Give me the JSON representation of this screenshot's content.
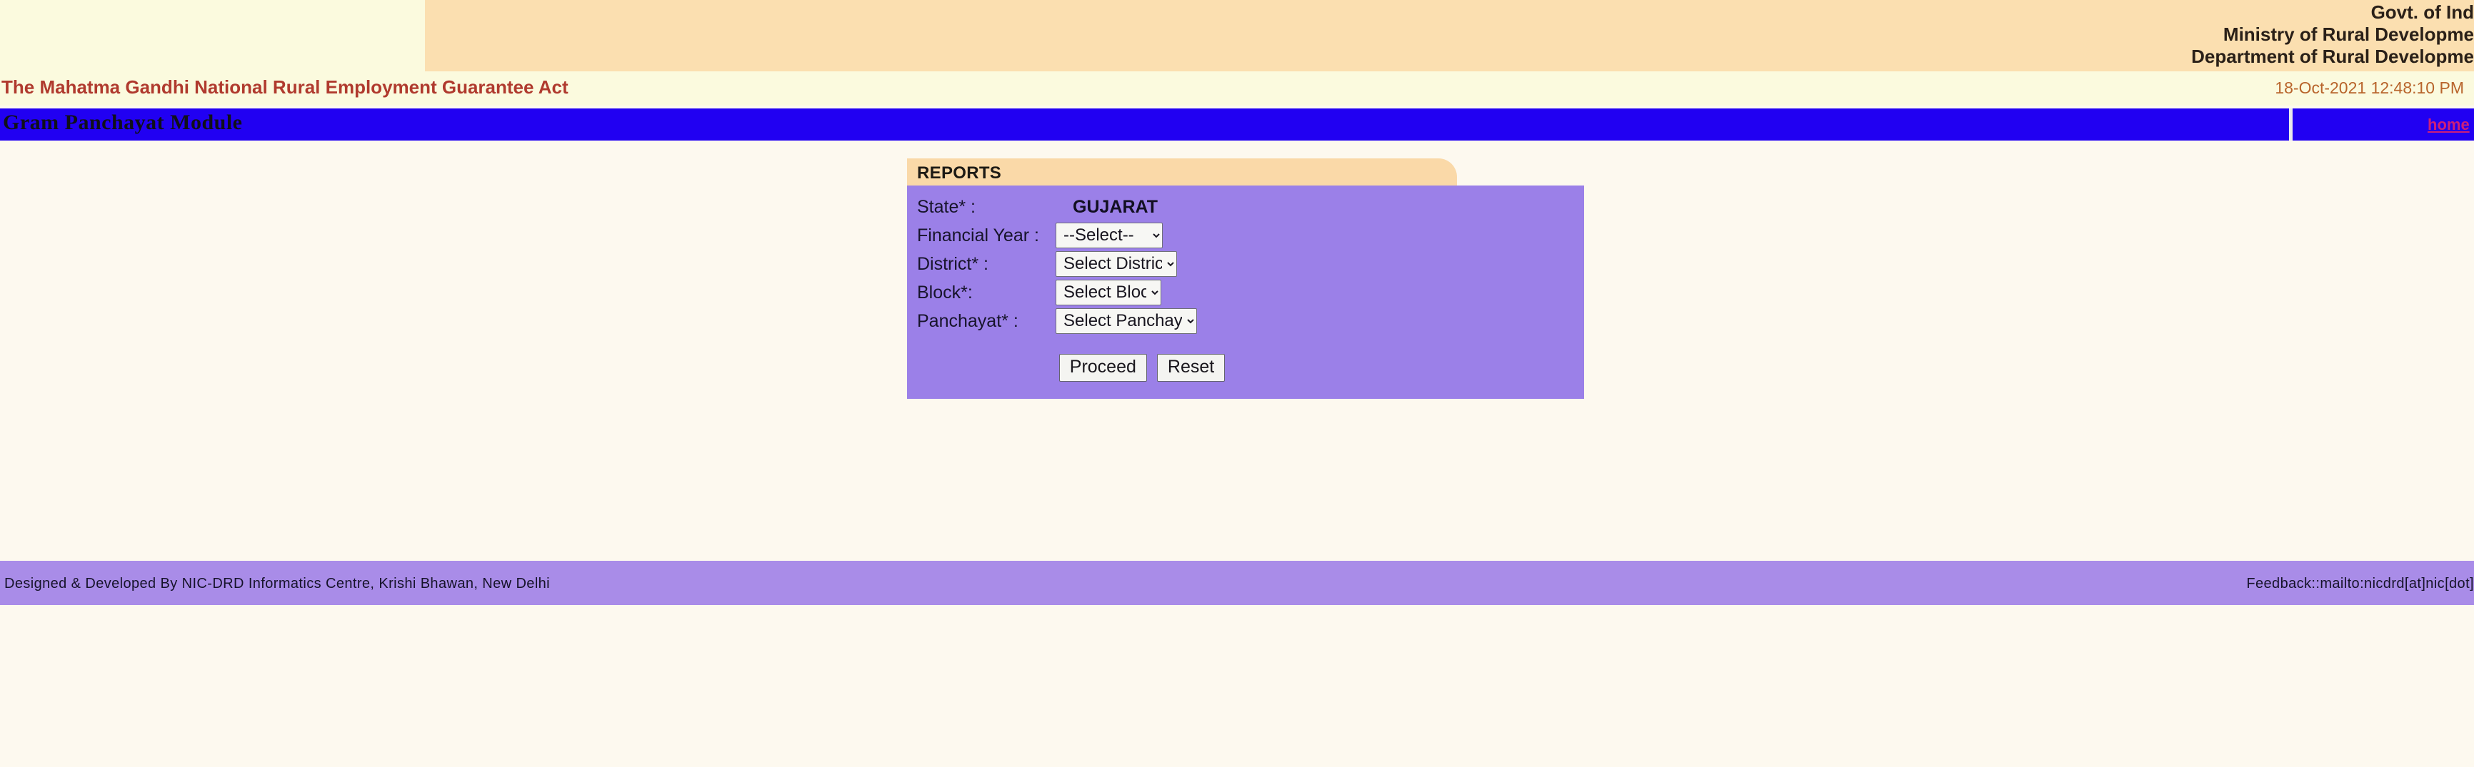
{
  "banner": {
    "gov_lines": [
      "Govt. of Ind",
      "Ministry of Rural Developme",
      "Department of Rural Developme"
    ],
    "peach_color": "#fbdfb0",
    "cream_color": "#fbfade"
  },
  "act_strip": {
    "title": "The Mahatma Gandhi National Rural Employment Guarantee Act",
    "datetime": "18-Oct-2021 12:48:10 PM",
    "title_color": "#b03a2e",
    "datetime_color": "#b8642b"
  },
  "navbar": {
    "module_title": "Gram Panchayat Module",
    "home_link": "home",
    "bar_color": "#2100f2",
    "link_color": "#cc1f7a"
  },
  "panel": {
    "header_label": "REPORTS",
    "header_color": "#fad9a8",
    "body_color": "#9b80e8",
    "rows": [
      {
        "label": "State* :",
        "type": "text",
        "value": "GUJARAT"
      },
      {
        "label": "Financial Year :",
        "type": "select",
        "value": "--Select--",
        "options": [
          "--Select--"
        ]
      },
      {
        "label": "District* :",
        "type": "select",
        "value": "Select District",
        "options": [
          "Select District"
        ]
      },
      {
        "label": "Block*:",
        "type": "select",
        "value": "Select Block",
        "options": [
          "Select Block"
        ]
      },
      {
        "label": "Panchayat* :",
        "type": "select",
        "value": "Select Panchayat",
        "options": [
          "Select Panchayat"
        ]
      }
    ],
    "buttons": {
      "proceed": "Proceed",
      "reset": "Reset"
    }
  },
  "footer": {
    "left": "Designed & Developed By NIC-DRD Informatics Centre, Krishi Bhawan, New Delhi",
    "right": "Feedback::mailto:nicdrd[at]nic[dot]",
    "bar_color": "#a98ce8"
  }
}
